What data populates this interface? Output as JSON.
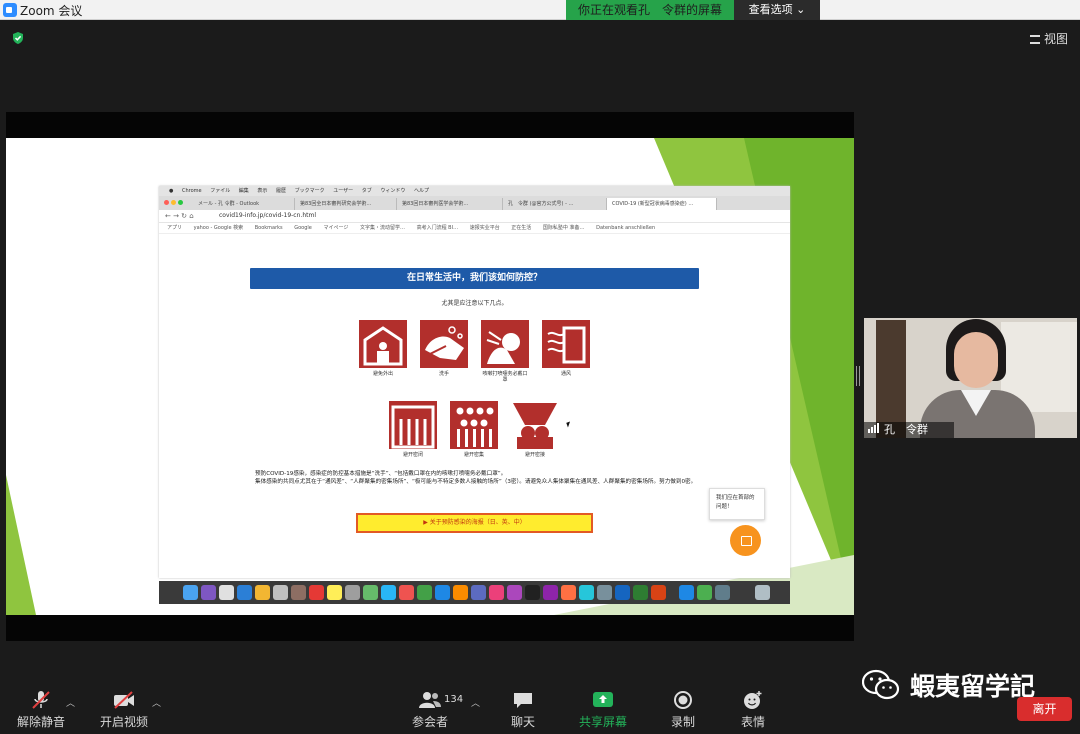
{
  "window": {
    "title": "Zoom 会议"
  },
  "share_banner": {
    "text": "你正在观看孔　令群的屏幕",
    "view_options": "查看选项 ⌄"
  },
  "top_right": {
    "view_label": "视图"
  },
  "browser": {
    "menu": [
      "",
      "Chrome",
      "ファイル",
      "編集",
      "表示",
      "履歴",
      "ブックマーク",
      "ユーザー",
      "タブ",
      "ウィンドウ",
      "ヘルプ"
    ],
    "tabs": [
      "メール - 孔 令群 - Outlook",
      "第83回全日本審判研究会学術…",
      "第83回日本審判医学会学術…",
      "孔　令群 (@官方公式号) - …",
      "COVID-19 (新型冠状病毒感染症) …"
    ],
    "url": "covid19-info.jp/covid-19-cn.html",
    "bookmarks": [
      "アプリ",
      "yahoo - Google 検索",
      "Bookmarks",
      "Google",
      "マイページ",
      "文字集・流动留学…",
      "高考入门流程 BI…",
      "速报实业平台",
      "正在生活",
      "国际私塾中 准备…",
      "Datenbank anschließen"
    ]
  },
  "page": {
    "heading": "在日常生活中，我们该如何防控？",
    "subheading": "尤其是应注意以下几点。",
    "icons": [
      {
        "label": "避免外出"
      },
      {
        "label": "洗手"
      },
      {
        "label": "咳嗽打喷嚏务必戴口罩"
      },
      {
        "label": "通风"
      },
      {
        "label": "避开密闭"
      },
      {
        "label": "避开密集"
      },
      {
        "label": "避开密接"
      }
    ],
    "body_lines": [
      "预防COVID-19感染，感染症的防控基本措施是“洗手”、“包括戴口罩在内的咳嗽打喷嚏务必戴口罩”。",
      "集体感染的共同点尤其在于“通风差”、“人群聚集的密集场所”、“极可能与不特定多数人接触的场所”（3密）。请避免众人集体聚集在通风差、人群聚集的密集场所。努力做到0密。"
    ],
    "link_button": "▶ 关于预防感染的海报（日、英、中）",
    "chat_popup": "我们应在首部的问题！"
  },
  "participant": {
    "name": "孔　令群"
  },
  "toolbar": {
    "mute": "解除静音",
    "video": "开启视频",
    "participants": "参会者",
    "participants_count": "134",
    "chat": "聊天",
    "share": "共享屏幕",
    "record": "录制",
    "reactions": "表情",
    "leave": "离开"
  },
  "watermark": {
    "text": "蝦夷留学記"
  },
  "colors": {
    "share_green": "#26a34a",
    "leave_red": "#d92d2d",
    "slide_blue": "#1e5aa8",
    "icon_red": "#b22f2c",
    "link_yellow": "#ffec2e"
  }
}
